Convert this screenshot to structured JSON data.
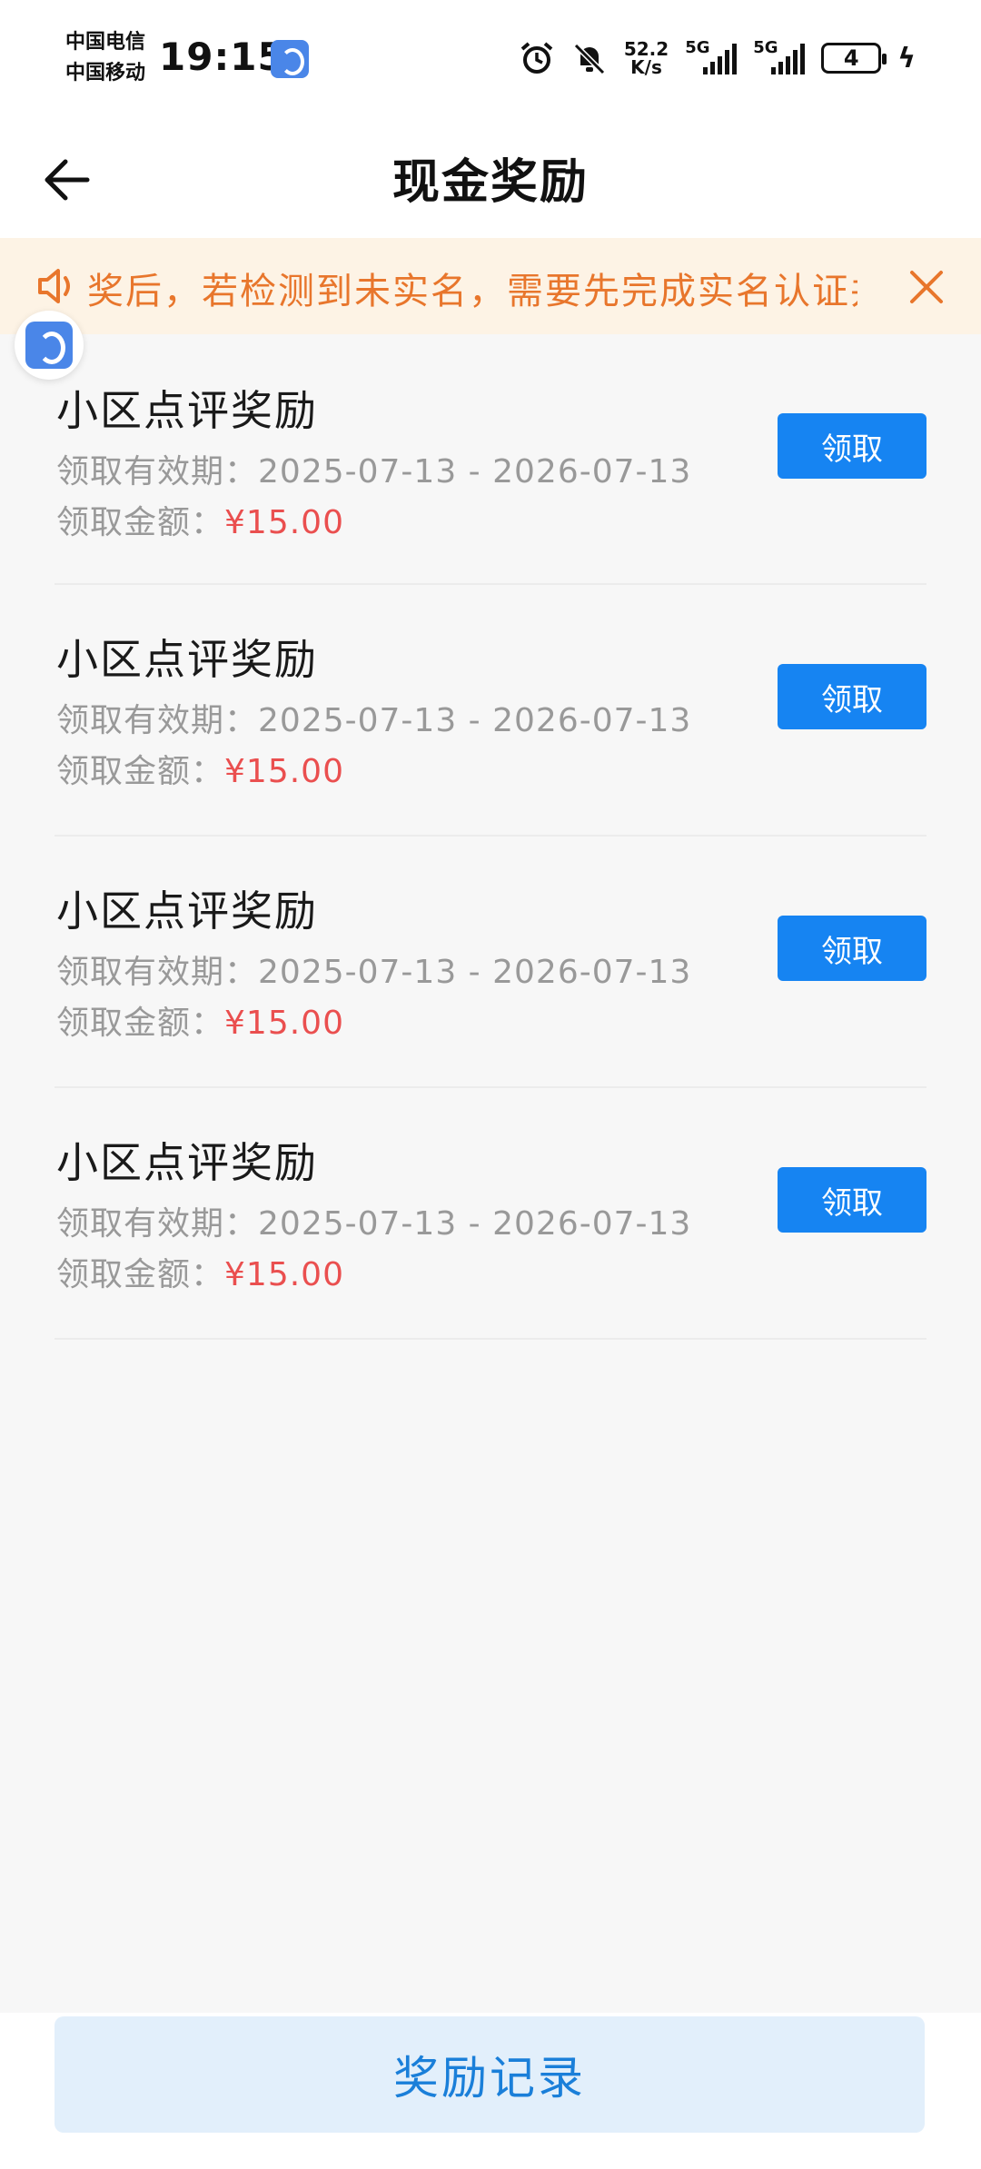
{
  "status_bar": {
    "carrier_1": "中国电信",
    "carrier_2": "中国移动",
    "time": "19:15",
    "net_speed_value": "52.2",
    "net_speed_unit": "K/s",
    "signal_1_label": "5G",
    "signal_2_label": "5G",
    "battery_level": "4"
  },
  "header": {
    "title": "现金奖励"
  },
  "notice": {
    "text": "奖后，若检测到未实名，需要先完成实名认证并"
  },
  "rewards": [
    {
      "name": "小区点评奖励",
      "period_label": "领取有效期：",
      "period": "2025-07-13 - 2026-07-13",
      "amount_label": "领取金额：",
      "amount": "¥15.00",
      "button": "领取"
    },
    {
      "name": "小区点评奖励",
      "period_label": "领取有效期：",
      "period": "2025-07-13 - 2026-07-13",
      "amount_label": "领取金额：",
      "amount": "¥15.00",
      "button": "领取"
    },
    {
      "name": "小区点评奖励",
      "period_label": "领取有效期：",
      "period": "2025-07-13 - 2026-07-13",
      "amount_label": "领取金额：",
      "amount": "¥15.00",
      "button": "领取"
    },
    {
      "name": "小区点评奖励",
      "period_label": "领取有效期：",
      "period": "2025-07-13 - 2026-07-13",
      "amount_label": "领取金额：",
      "amount": "¥15.00",
      "button": "领取"
    }
  ],
  "footer": {
    "record_button": "奖励记录"
  },
  "colors": {
    "primary": "#1684f2",
    "amount": "#ea4f4f",
    "notice_text": "#e8762c",
    "notice_bg": "#fdf3e5",
    "record_bg": "#e2effb"
  },
  "icons": {
    "back": "arrow-left-icon",
    "speaker": "speaker-icon",
    "close": "close-icon",
    "alarm": "alarm-icon",
    "mute": "bell-off-icon",
    "app": "app-k-icon"
  }
}
